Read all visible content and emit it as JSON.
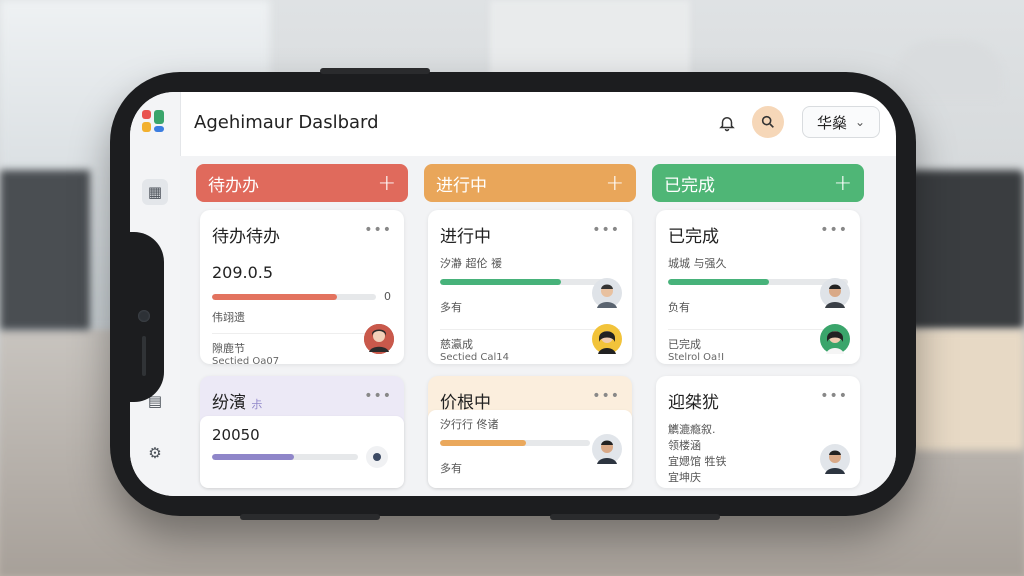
{
  "header": {
    "title": "Agehimaur Daslbard",
    "lang_label": "华燊",
    "chevron": "⌄",
    "bell_icon": "🔔",
    "search_icon": "⌕"
  },
  "sidebar": {
    "dashboard_icon": "▦",
    "docs_icon": "▤",
    "settings_icon": "⚙"
  },
  "columns": [
    {
      "name": "待办办",
      "plus": "+",
      "color": "#e06a5c",
      "cards": [
        {
          "title": "待办待办",
          "dots": "•••",
          "value": "209.0.5",
          "progress": 0.76,
          "progress_color": "#e3735f",
          "count": "0",
          "label": "伟翊遗",
          "foot1": "隙鹿节",
          "foot2": "Sectied Oa07"
        },
        {
          "title": "纷濱",
          "title_suffix": "尗",
          "dots": "•••",
          "value": "20050",
          "progress": 0.56,
          "progress_color": "#8f86c9"
        }
      ]
    },
    {
      "name": "进行中",
      "plus": "+",
      "color": "#e9a65a",
      "cards": [
        {
          "title": "进行中",
          "dots": "•••",
          "subtitle": "汐瀞 超伦 禐",
          "progress": 0.74,
          "progress_color": "#47b27a",
          "owner": "多有",
          "foot1": "慈瀛成",
          "foot2": "Sectied Cal14"
        },
        {
          "title": "价根中",
          "dots": "•••",
          "subtitle": "汐行行 佟诸",
          "progress": 0.5,
          "progress_color": "#eaa85c",
          "owner": "多有"
        }
      ]
    },
    {
      "name": "已完成",
      "plus": "+",
      "color": "#4fb676",
      "cards": [
        {
          "title": "已完成",
          "dots": "•••",
          "subtitle": "城城 与强久",
          "progress": 0.56,
          "progress_color": "#47b27a",
          "owner": "负有",
          "foot1": "已完成",
          "foot2": "Stelrol Oa!I"
        },
        {
          "title": "迎桀犹",
          "dots": "•••",
          "lines": [
            "觽漉瘾叙.",
            "领楼涵",
            "宜媤馆 牲铁",
            "宜坤庆"
          ]
        }
      ]
    }
  ]
}
